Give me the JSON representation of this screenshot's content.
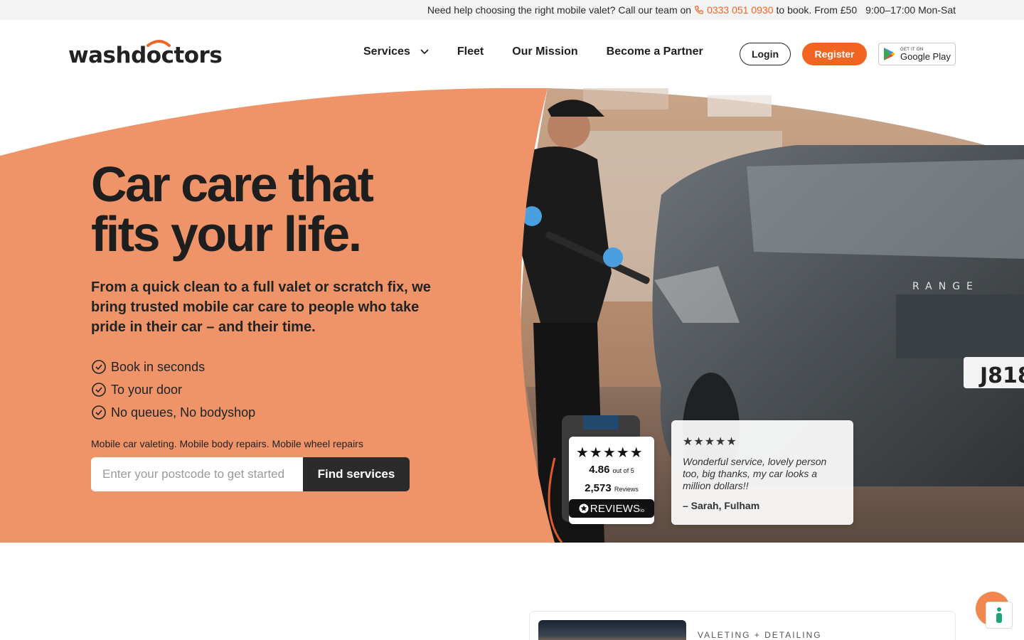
{
  "topbar": {
    "message": "Need help choosing the right mobile valet? Call our team on",
    "phone": "0333 051 0930",
    "after_phone": "to book. From £50",
    "hours": "9:00–17:00 Mon-Sat"
  },
  "header": {
    "logo_text": "washdoctors",
    "nav": [
      "Services",
      "Fleet",
      "Our Mission",
      "Become a Partner"
    ],
    "login_label": "Login",
    "register_label": "Register",
    "store_badge": {
      "small": "GET IT ON",
      "big": "Google Play"
    }
  },
  "hero": {
    "title_line1": "Car care that",
    "title_line2": "fits your life.",
    "subtitle": "From a quick clean to a full valet or scratch fix, we bring trusted mobile car care to people who take pride in their car – and their time.",
    "checks": [
      "Book in seconds",
      "To your door",
      "No queues, No bodyshop"
    ],
    "services_line": "Mobile car valeting. Mobile body repairs. Mobile wheel repairs",
    "postcode_placeholder": "Enter your postcode to get started",
    "find_button": "Find services"
  },
  "rating": {
    "stars": "★★★★★",
    "score": "4.86",
    "score_suffix": "out of 5",
    "count": "2,573",
    "count_suffix": "Reviews",
    "brand": "REVIEWS",
    "brand_suffix": "io"
  },
  "testimonial": {
    "stars": "★★★★★",
    "quote": "Wonderful service, lovely person too, big thanks, my car looks a million dollars!!",
    "author": "– Sarah, Fulham"
  },
  "photo_detail": {
    "badge": "RANGE",
    "plate": "J818"
  },
  "lower": {
    "tag": "VALETING + DETAILING"
  },
  "colors": {
    "brand_orange": "#f26422",
    "hero_orange": "#ef9468",
    "dark": "#2b2b2b"
  }
}
